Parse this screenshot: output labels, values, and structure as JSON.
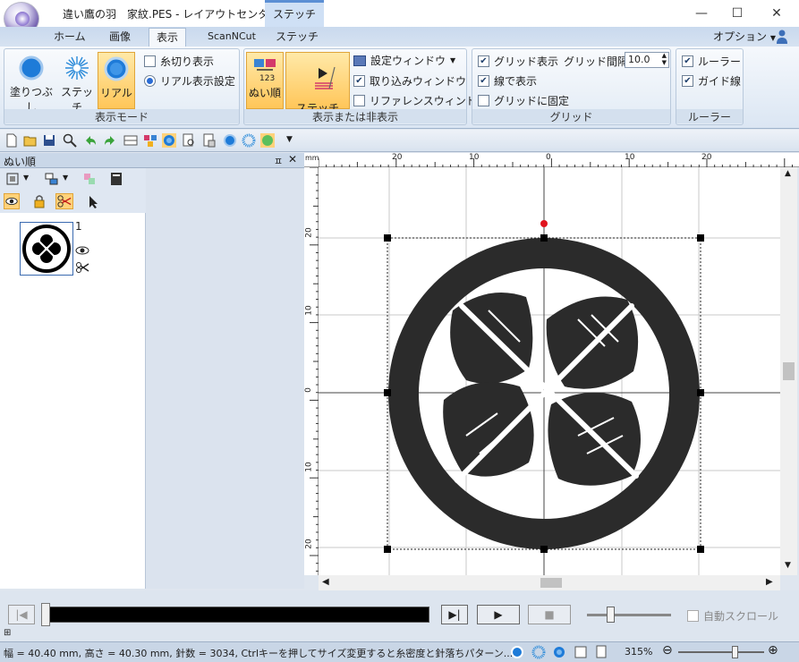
{
  "window": {
    "title": "違い鷹の羽　家紋.PES - レイアウトセンター",
    "context_tab": "ステッチ",
    "minimize": "—",
    "maximize": "☐",
    "close": "✕"
  },
  "tabs": [
    "ホーム",
    "画像",
    "表示",
    "ScanNCut",
    "ステッチ"
  ],
  "active_tab": "表示",
  "options_label": "オプション",
  "ribbon": {
    "display_mode": {
      "label": "表示モード",
      "fill": "塗りつぶし",
      "stitch": "ステッチ",
      "real": "リアル",
      "thread_cut": "糸切り表示",
      "real_settings": "リアル表示設定"
    },
    "show_hide": {
      "label": "表示または非表示",
      "sew_order": "ぬい順",
      "simulator": "ステッチ\nシミュレーター",
      "settings_window": "設定ウィンドウ",
      "import_window": "取り込みウィンドウ",
      "reference_window": "リファレンスウィンドウ",
      "settings_checked": false,
      "import_checked": true,
      "reference_checked": false
    },
    "grid": {
      "label": "グリッド",
      "show_grid": "グリッド表示",
      "grid_interval_label": "グリッド間隔:",
      "grid_interval_value": "10.0",
      "show_lines": "線で表示",
      "snap": "グリッドに固定",
      "show_grid_checked": true,
      "show_lines_checked": true,
      "snap_checked": false
    },
    "ruler": {
      "label": "ルーラー",
      "ruler": "ルーラー",
      "guide": "ガイド線",
      "ruler_checked": true,
      "guide_checked": true
    }
  },
  "pane": {
    "title": "ぬい順",
    "pin": "ㅍ",
    "close": "✕",
    "item_number": "1"
  },
  "ruler": {
    "unit": "mm",
    "top_labels": [
      "20",
      "10",
      "0",
      "10",
      "20"
    ],
    "left_labels": [
      "20",
      "10",
      "0",
      "10",
      "20"
    ]
  },
  "playback": {
    "auto_scroll": "自動スクロール"
  },
  "status": {
    "info": "幅 = 40.40 mm, 高さ = 40.30 mm, 針数 = 3034, Ctrlキーを押してサイズ変更すると糸密度と針落ちパターン...",
    "zoom": "315%"
  },
  "colors": {
    "accent": "#5b8fd4",
    "active_button": "#ffc659",
    "embroidery": "#2b2b2b",
    "selection_point": "#e0141e"
  }
}
